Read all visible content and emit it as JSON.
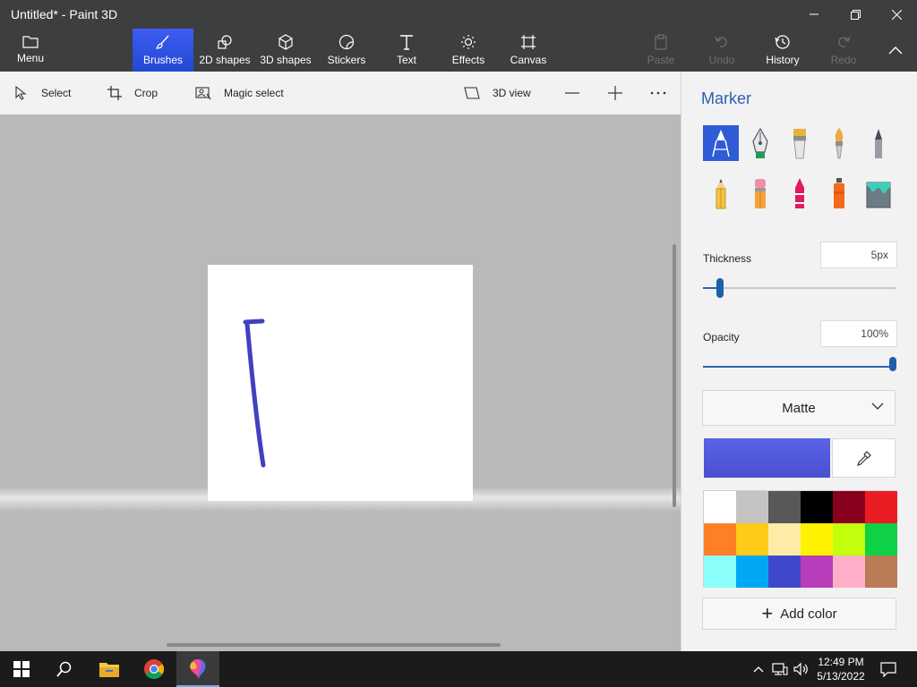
{
  "window": {
    "title": "Untitled* - Paint 3D",
    "controls": {
      "minimize_icon": "minimize-icon",
      "restore_icon": "restore-icon",
      "close_icon": "close-icon"
    }
  },
  "ribbon": {
    "menu_label": "Menu",
    "tabs": [
      {
        "label": "Brushes",
        "icon": "brush-icon",
        "active": true
      },
      {
        "label": "2D shapes",
        "icon": "2d-shapes-icon"
      },
      {
        "label": "3D shapes",
        "icon": "3d-shapes-icon"
      },
      {
        "label": "Stickers",
        "icon": "stickers-icon"
      },
      {
        "label": "Text",
        "icon": "text-icon"
      },
      {
        "label": "Effects",
        "icon": "effects-icon"
      },
      {
        "label": "Canvas",
        "icon": "canvas-icon"
      }
    ],
    "actions": [
      {
        "label": "Paste",
        "icon": "paste-icon",
        "enabled": false
      },
      {
        "label": "Undo",
        "icon": "undo-icon",
        "enabled": false
      },
      {
        "label": "History",
        "icon": "history-icon",
        "enabled": true
      },
      {
        "label": "Redo",
        "icon": "redo-icon",
        "enabled": false
      }
    ]
  },
  "toolbar": {
    "select_label": "Select",
    "crop_label": "Crop",
    "magic_select_label": "Magic select",
    "view3d_label": "3D view"
  },
  "panel": {
    "title": "Marker",
    "brushes": [
      "marker",
      "calligraphy-pen",
      "oil-brush",
      "watercolor",
      "pixel-pen",
      "pencil",
      "eraser",
      "crayon",
      "spray-can",
      "fill"
    ],
    "selected_brush": "marker",
    "thickness_label": "Thickness",
    "thickness_value": "5px",
    "thickness_level": 0.05,
    "opacity_label": "Opacity",
    "opacity_value": "100%",
    "opacity_level": 1.0,
    "finish_value": "Matte",
    "current_color": "#4a50d0",
    "palette": [
      "#ffffff",
      "#c3c3c3",
      "#585858",
      "#000000",
      "#88001b",
      "#ec1c24",
      "#ff7f27",
      "#ffca18",
      "#fdeca6",
      "#fff200",
      "#c4ff0e",
      "#0ed145",
      "#8cfffb",
      "#00a8f3",
      "#3f48cc",
      "#b83dba",
      "#ffaec8",
      "#b97a56"
    ],
    "add_color_label": "Add color"
  },
  "canvas": {
    "stroke_color": "#4040c0"
  },
  "taskbar": {
    "time": "12:49 PM",
    "date": "5/13/2022"
  }
}
